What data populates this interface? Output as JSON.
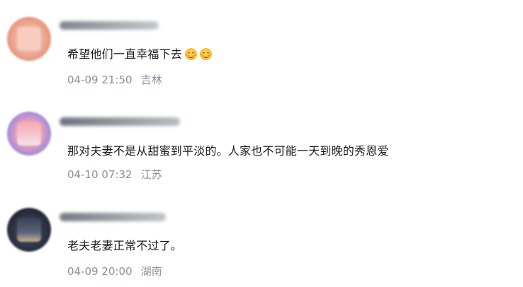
{
  "comments": [
    {
      "avatar_colors": [
        "#e58a6a",
        "#f3c1b0"
      ],
      "username_color": "#9aa0a8",
      "text": "希望他们一直幸福下去",
      "emojis": [
        "smiling-face-emoji",
        "smiling-face-emoji"
      ],
      "timestamp": "04-09 21:50",
      "location": "吉林"
    },
    {
      "avatar_colors": [
        "#8a86e8",
        "#f0a7b4"
      ],
      "username_color": "#9aa0a8",
      "text": "那对夫妻不是从甜蜜到平淡的。人家也不可能一天到晚的秀恩爱",
      "emojis": [],
      "timestamp": "04-10 07:32",
      "location": "江苏"
    },
    {
      "avatar_colors": [
        "#2c3145",
        "#6a7389"
      ],
      "username_color": "#9aa0a8",
      "text": "老夫老妻正常不过了。",
      "emojis": [],
      "timestamp": "04-09 20:00",
      "location": "湖南"
    }
  ]
}
